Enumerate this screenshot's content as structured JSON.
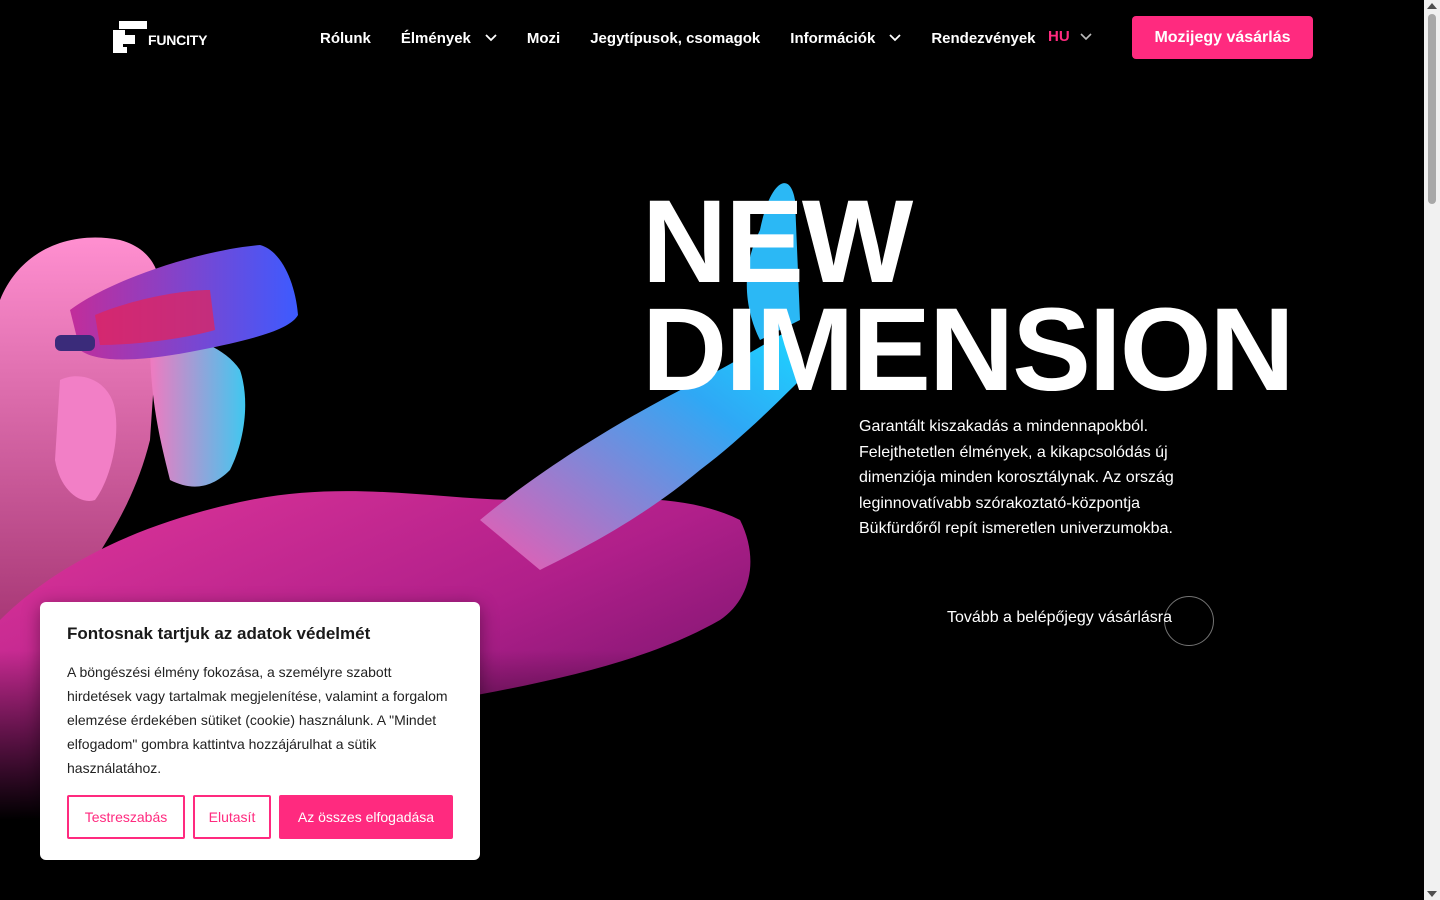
{
  "brand": {
    "logo_text": "FUNCITY",
    "accent_color": "#ff2a7f"
  },
  "nav": {
    "items": [
      {
        "label": "Rólunk",
        "has_dropdown": false
      },
      {
        "label": "Élmények",
        "has_dropdown": true
      },
      {
        "label": "Mozi",
        "has_dropdown": false
      },
      {
        "label": "Jegytípusok, csomagok",
        "has_dropdown": false
      },
      {
        "label": "Információk",
        "has_dropdown": true
      },
      {
        "label": "Rendezvények",
        "has_dropdown": false
      }
    ],
    "language": "HU",
    "cta_label": "Mozijegy vásárlás"
  },
  "hero": {
    "headline_line1": "NEW",
    "headline_line2": "DIMENSION",
    "description": "Garantált kiszakadás a mindennapokból. Felejthetetlen élmények, a kikapcsolódás új dimenziója minden korosztálynak. Az ország leginnovatívabb szórakoztató-központja Bükfürdőről repít ismeretlen univerzumokba.",
    "link_label": "Tovább a belépőjegy vásárlásra",
    "image_description_icon": "vr-headset-woman-image"
  },
  "cookie": {
    "title": "Fontosnak tartjuk az adatok védelmét",
    "body": "A böngészési élmény fokozása, a személyre szabott hirdetések vagy tartalmak megjelenítése, valamint a forgalom elemzése érdekében sütiket (cookie) használunk. A \"Mindet elfogadom\" gombra kattintva hozzájárulhat a sütik használatához.",
    "customize_label": "Testreszabás",
    "reject_label": "Elutasít",
    "accept_all_label": "Az összes elfogadása"
  }
}
